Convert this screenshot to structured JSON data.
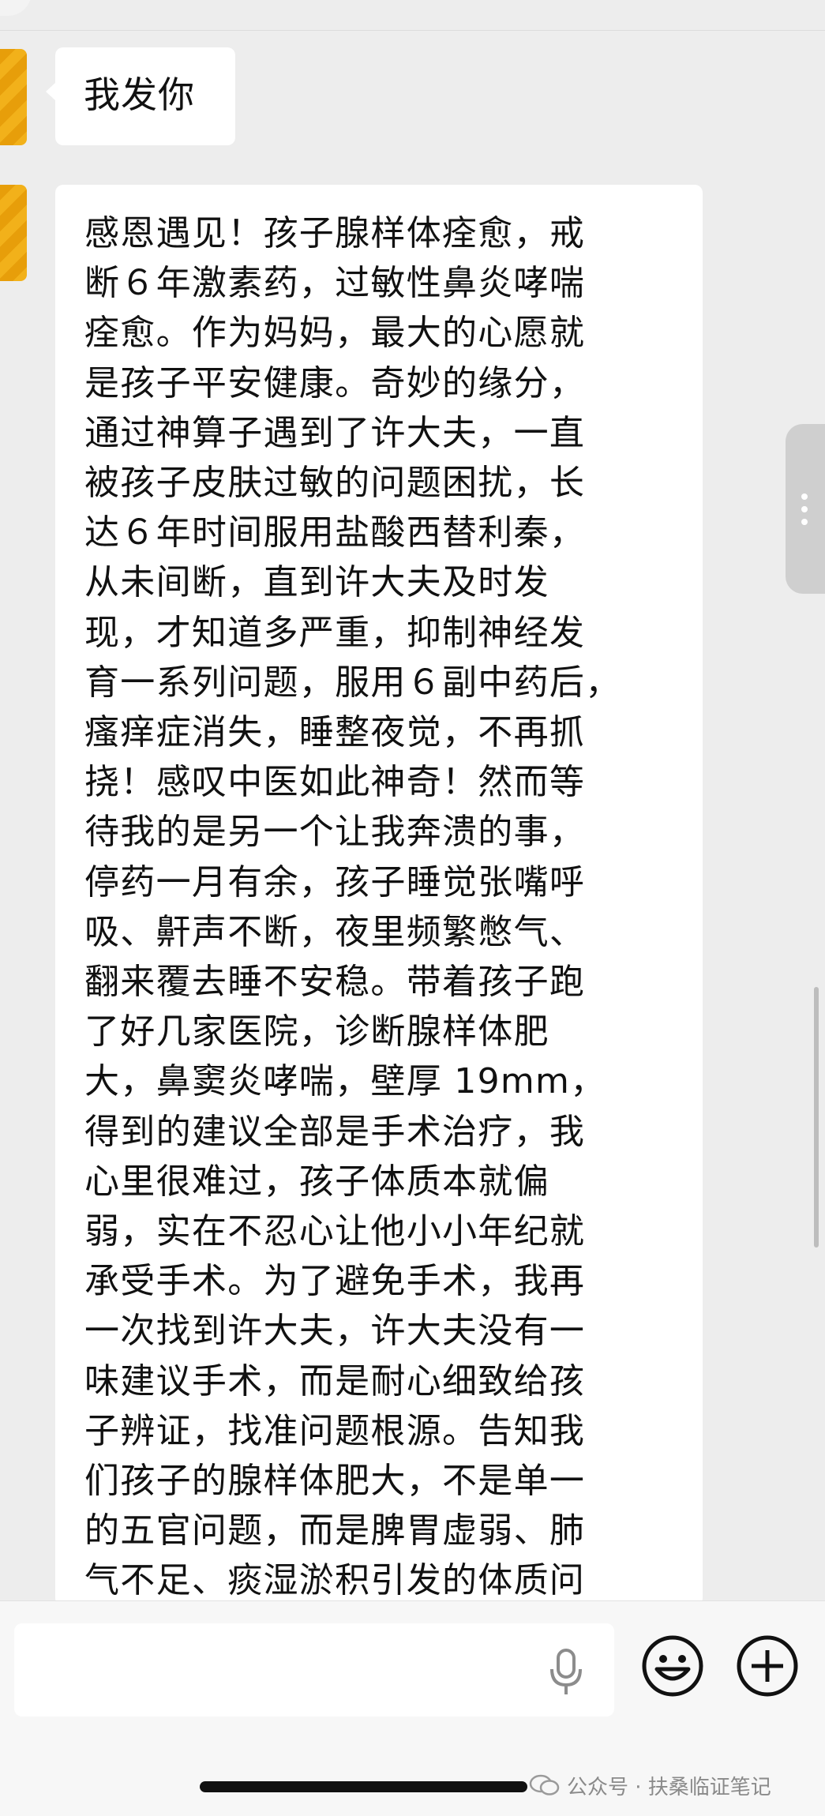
{
  "messages": [
    {
      "text": "我发你"
    },
    {
      "text": "感恩遇见！孩子腺样体痊愈，戒\n断６年激素药，过敏性鼻炎哮喘\n痊愈。作为妈妈，最大的心愿就\n是孩子平安健康。奇妙的缘分，\n通过神算子遇到了许大夫，一直\n被孩子皮肤过敏的问题困扰，长\n达６年时间服用盐酸西替利秦，\n从未间断，直到许大夫及时发\n现，才知道多严重，抑制神经发\n育一系列问题，服用６副中药后，\n瘙痒症消失，睡整夜觉，不再抓\n挠！感叹中医如此神奇！然而等\n待我的是另一个让我奔溃的事，\n停药一月有余，孩子睡觉张嘴呼\n吸、鼾声不断，夜里频繁憋气、\n翻来覆去睡不安稳。带着孩子跑\n了好几家医院，诊断腺样体肥\n大，鼻窦炎哮喘，壁厚 19mm，\n得到的建议全部是手术治疗，我\n心里很难过，孩子体质本就偏\n弱，实在不忍心让他小小年纪就\n承受手术。为了避免手术，我再\n一次找到许大夫，许大夫没有一\n味建议手术，而是耐心细致给孩\n子辨证，找准问题根源。告知我\n们孩子的腺样体肥大，不是单一\n的五官问题，而是脾胃虚弱、肺\n气不足、痰湿淤积引发的体质问"
    }
  ],
  "input": {
    "placeholder": ""
  },
  "icons": {
    "voice": "microphone-icon",
    "emoji": "smiley-face-icon",
    "more": "plus-circle-icon",
    "handle": "vertical-dots-icon"
  },
  "watermark": {
    "text": "公众号 · 扶桑临证笔记"
  },
  "colors": {
    "background": "#ededed",
    "bubble": "#ffffff",
    "avatar": "#f2b11a"
  }
}
